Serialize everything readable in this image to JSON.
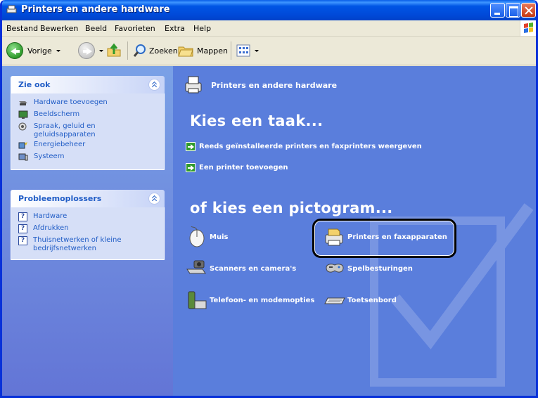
{
  "window": {
    "title": "Printers en andere hardware"
  },
  "menu": [
    "Bestand",
    "Bewerken",
    "Beeld",
    "Favorieten",
    "Extra",
    "Help"
  ],
  "toolbar": {
    "back_label": "Vorige",
    "search_label": "Zoeken",
    "folders_label": "Mappen"
  },
  "left_pane": {
    "see_also": {
      "title": "Zie ook",
      "items": [
        {
          "label": "Hardware toevoegen",
          "icon": "add-hardware-icon"
        },
        {
          "label": "Beeldscherm",
          "icon": "display-icon"
        },
        {
          "label": "Spraak, geluid en geluidsapparaten",
          "icon": "sound-icon"
        },
        {
          "label": "Energiebeheer",
          "icon": "power-icon"
        },
        {
          "label": "Systeem",
          "icon": "system-icon"
        }
      ]
    },
    "troubleshooters": {
      "title": "Probleemoplossers",
      "items": [
        {
          "label": "Hardware",
          "icon": "help-icon"
        },
        {
          "label": "Afdrukken",
          "icon": "help-icon"
        },
        {
          "label": "Thuisnetwerken of kleine bedrijfsnetwerken",
          "icon": "help-icon"
        }
      ]
    }
  },
  "main": {
    "header": "Printers en andere hardware",
    "pick_task": "Kies een taak...",
    "tasks": [
      "Reeds geïnstalleerde printers en faxprinters weergeven",
      "Een printer toevoegen"
    ],
    "pick_icon": "of kies een pictogram...",
    "categories": [
      {
        "label": "Muis",
        "icon": "mouse-icon"
      },
      {
        "label": "Printers en faxapparaten",
        "icon": "printer-icon"
      },
      {
        "label": "Scanners en camera's",
        "icon": "scanner-icon"
      },
      {
        "label": "Spelbesturingen",
        "icon": "gamepad-icon"
      },
      {
        "label": "Telefoon- en modemopties",
        "icon": "phone-icon"
      },
      {
        "label": "Toetsenbord",
        "icon": "keyboard-icon"
      }
    ]
  },
  "colors": {
    "title_bar": "#0055e5",
    "left_pane": "#6f8ee0",
    "main_pane": "#5a7edc",
    "link": "#215dc6"
  }
}
